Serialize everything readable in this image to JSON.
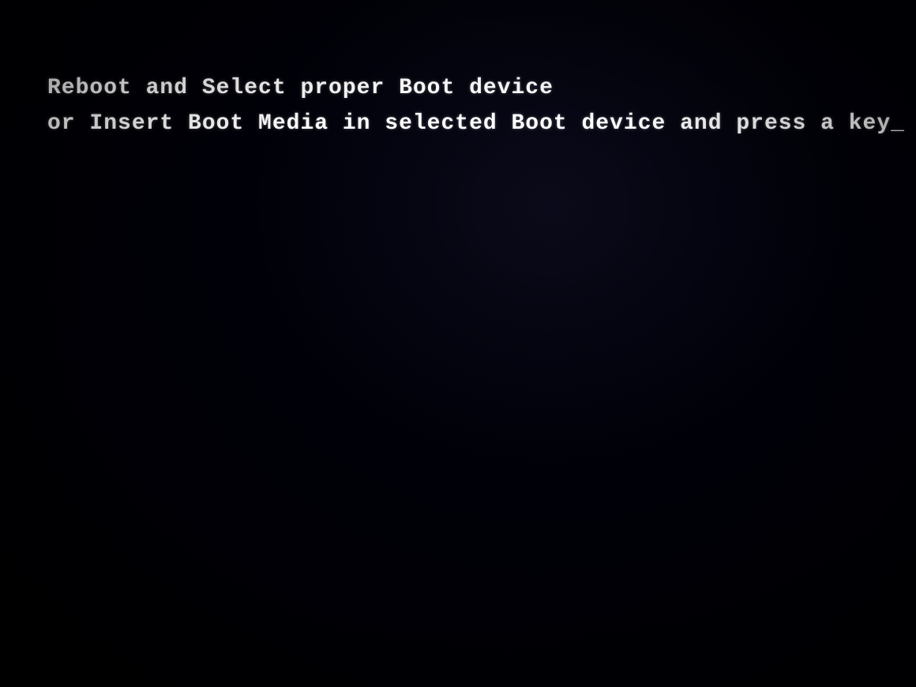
{
  "screen": {
    "background_color": "#000008",
    "boot_message": {
      "line1": "Reboot and Select proper Boot device",
      "line2": "or Insert Boot Media in selected Boot device and press a key_"
    }
  }
}
